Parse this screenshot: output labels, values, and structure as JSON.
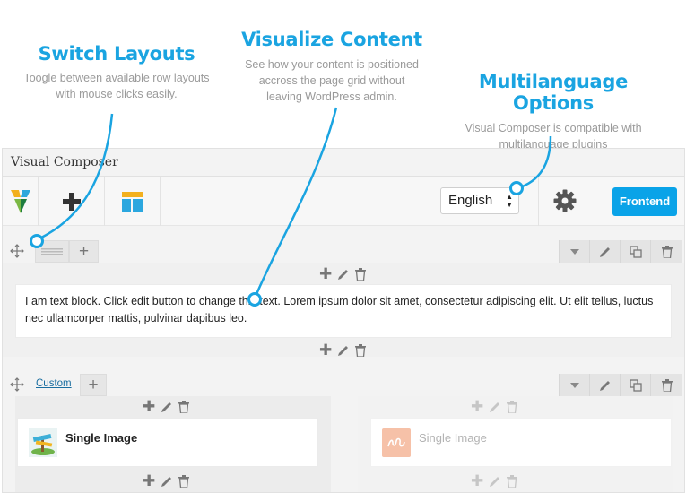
{
  "callouts": {
    "switch": {
      "title": "Switch Layouts",
      "line1": "Toogle between available row layouts",
      "line2": "with mouse clicks easily."
    },
    "visualize": {
      "title": "Visualize Content",
      "line1": "See how your content is positioned",
      "line2": "accross the page grid without",
      "line3": "leaving WordPress admin."
    },
    "multilang": {
      "title": "Multilanguage Options",
      "line1": "Visual Composer is compatible with",
      "line2": "multilanguage plugins"
    }
  },
  "app": {
    "title": "Visual Composer"
  },
  "toolbar": {
    "language": "English",
    "frontend_label": "Frontend",
    "icons": [
      "vc-logo-icon",
      "add-element-icon",
      "templates-icon",
      "gear-icon"
    ]
  },
  "row1": {
    "layout_add": "+",
    "text_block": "I am text block. Click edit button to change this text. Lorem ipsum dolor sit amet, consectetur adipiscing elit. Ut elit tellus, luctus nec ullamcorper mattis, pulvinar dapibus leo."
  },
  "row2": {
    "layout_label": "Custom",
    "layout_add": "+",
    "element1_label": "Single Image",
    "element2_label": "Single Image"
  },
  "colors": {
    "accent": "#1aa4e1",
    "button": "#0aa3e8"
  }
}
